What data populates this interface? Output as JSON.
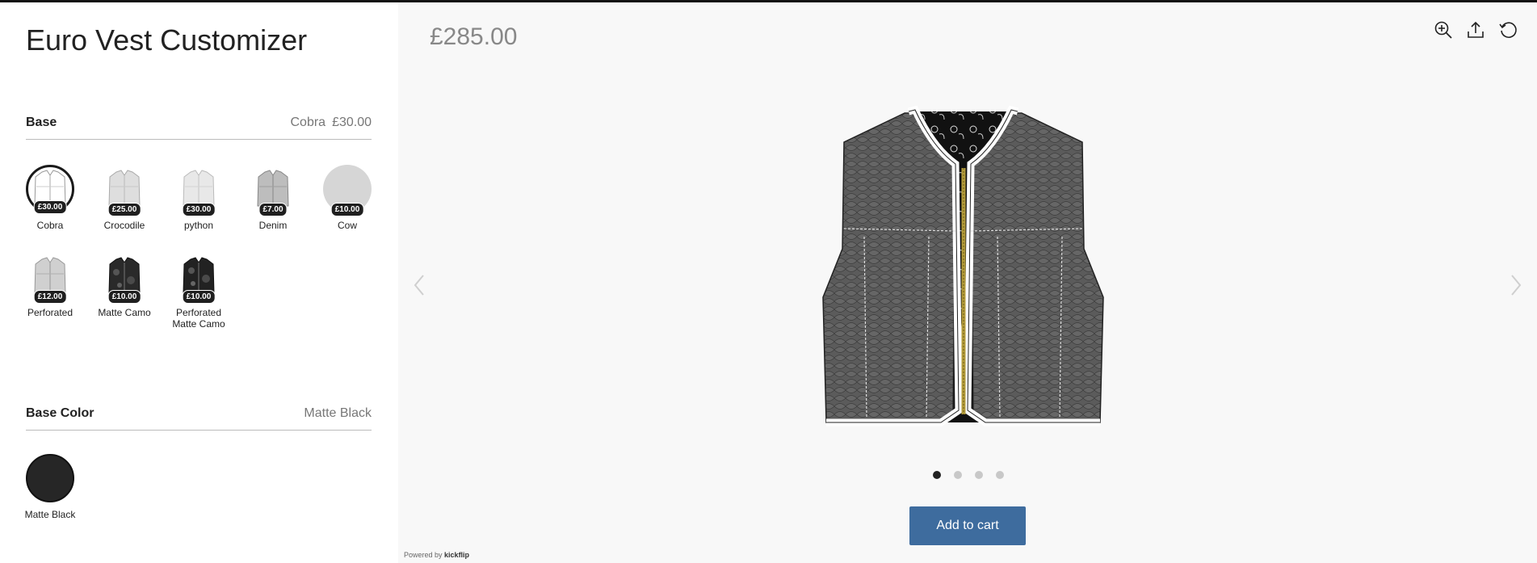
{
  "app": {
    "title": "Euro Vest Customizer"
  },
  "sections": {
    "base": {
      "title": "Base",
      "selected_name": "Cobra",
      "selected_price": "£30.00",
      "options": [
        {
          "label": "Cobra",
          "price": "£30.00",
          "selected": true
        },
        {
          "label": "Crocodile",
          "price": "£25.00"
        },
        {
          "label": "python",
          "price": "£30.00"
        },
        {
          "label": "Denim",
          "price": "£7.00"
        },
        {
          "label": "Cow",
          "price": "£10.00"
        },
        {
          "label": "Perforated",
          "price": "£12.00"
        },
        {
          "label": "Matte Camo",
          "price": "£10.00"
        },
        {
          "label": "Perforated Matte Camo",
          "price": "£10.00"
        }
      ]
    },
    "base_color": {
      "title": "Base Color",
      "selected_name": "Matte Black",
      "options": [
        {
          "label": "Matte Black",
          "color": "#262626",
          "selected": true
        }
      ]
    }
  },
  "main": {
    "price": "£285.00",
    "toolbar": {
      "icons": [
        "zoom-in-icon",
        "share-icon",
        "reset-icon"
      ]
    },
    "pagination": {
      "count": 4,
      "active": 1
    },
    "add_to_cart_label": "Add to cart",
    "powered_by_prefix": "Powered by",
    "powered_by_brand": "kickflip"
  },
  "colors": {
    "accent": "#3e6c9e",
    "panel_bg": "#f8f8f8"
  }
}
